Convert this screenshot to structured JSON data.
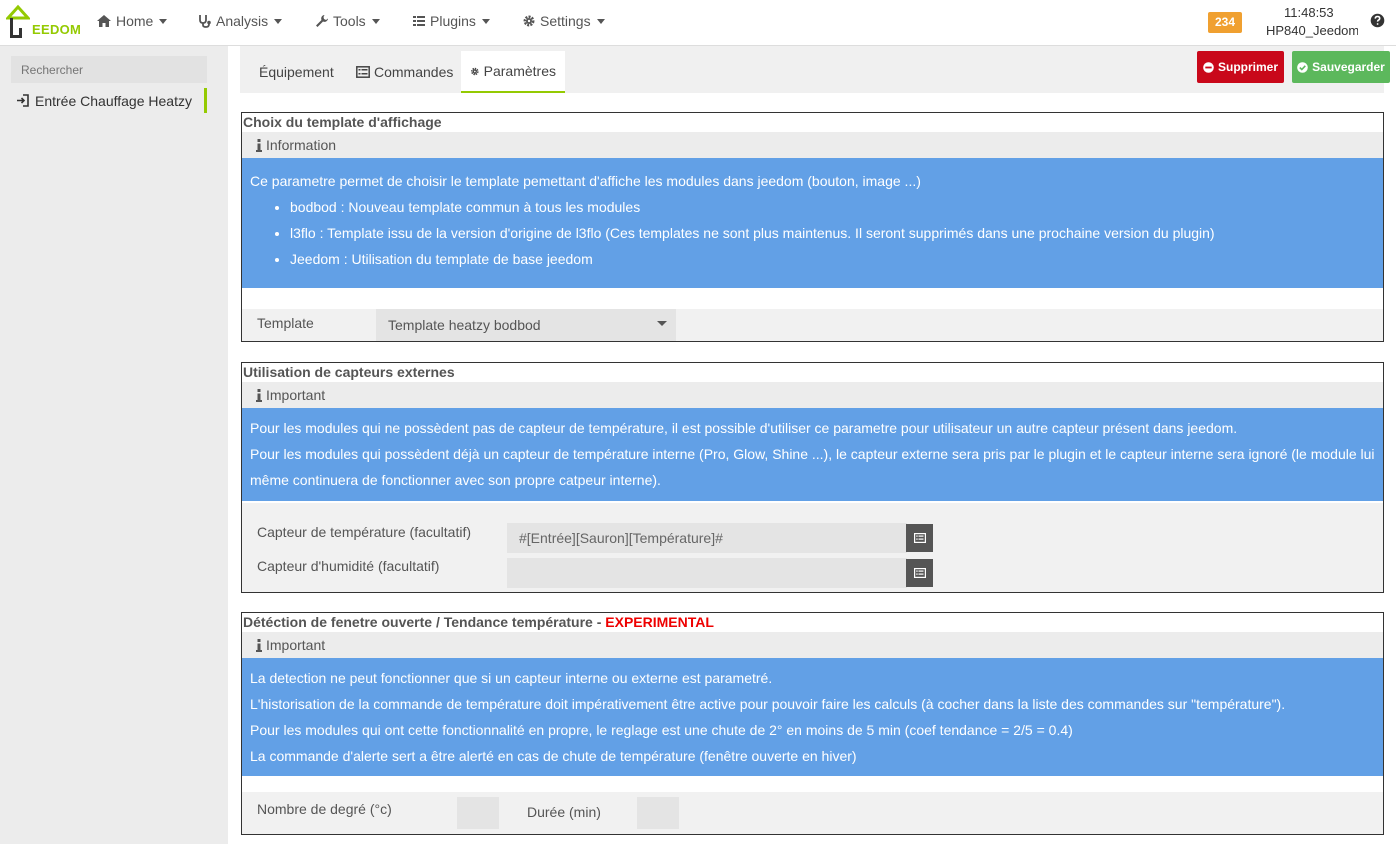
{
  "topbar": {
    "logo_text": "EEDOM",
    "menu": [
      {
        "label": "Home",
        "icon": "home-icon"
      },
      {
        "label": "Analysis",
        "icon": "stethoscope-icon"
      },
      {
        "label": "Tools",
        "icon": "wrench-icon"
      },
      {
        "label": "Plugins",
        "icon": "tasks-icon"
      },
      {
        "label": "Settings",
        "icon": "gear-icon"
      }
    ],
    "badge_count": "234",
    "badge_color": "#f0a030",
    "time": "11:48:53",
    "hostname": "HP840_Jeedom"
  },
  "sidebar": {
    "search_placeholder": "Rechercher",
    "items": [
      {
        "label": "Entrée Chauffage Heatzy",
        "icon": "sign-in-icon"
      }
    ]
  },
  "tabs": [
    {
      "label": "Équipement",
      "active": false
    },
    {
      "label": "Commandes",
      "icon": "list-icon",
      "active": false
    },
    {
      "label": "Paramètres",
      "icon": "gear-icon",
      "active": true
    }
  ],
  "actions": {
    "delete_label": "Supprimer",
    "save_label": "Sauvegarder",
    "delete_color": "#c9081a",
    "save_color": "#5cb85c"
  },
  "accent_color": "#94ca02",
  "info_color": "#62a0e6",
  "sections": {
    "template": {
      "title": "Choix du template d'affichage",
      "subtitle": "Information",
      "intro": "Ce parametre permet de choisir le template pemettant d'affiche les modules dans jeedom (bouton, image ...)",
      "bullets": [
        "bodbod : Nouveau template commun à tous les modules",
        "l3flo : Template issu de la version d'origine de l3flo (Ces templates ne sont plus maintenus. Il seront supprimés dans une prochaine version du plugin)",
        "Jeedom : Utilisation du template de base jeedom"
      ],
      "field_label": "Template",
      "field_value": "Template heatzy bodbod"
    },
    "sensors": {
      "title": "Utilisation de capteurs externes",
      "subtitle": "Important",
      "lines": [
        "Pour les modules qui ne possèdent pas de capteur de température, il est possible d'utiliser ce parametre pour utilisateur un autre capteur présent dans jeedom.",
        "Pour les modules qui possèdent déjà un capteur de température interne (Pro, Glow, Shine ...), le capteur externe sera pris par le plugin et le capteur interne sera ignoré (le module lui même continuera de fonctionner avec son propre catpeur interne)."
      ],
      "temp_label": "Capteur de température (facultatif)",
      "temp_value": "#[Entrée][Sauron][Température]#",
      "hum_label": "Capteur d'humidité (facultatif)",
      "hum_value": ""
    },
    "window": {
      "title": "Détéction de fenetre ouverte / Tendance température - ",
      "title_flag": "EXPERIMENTAL",
      "subtitle": "Important",
      "lines": [
        "La detection ne peut fonctionner que si un capteur interne ou externe est parametré.",
        "L'historisation de la commande de température doit impérativement être active pour pouvoir faire les calculs (à cocher dans la liste des commandes sur \"température\").",
        "Pour les modules qui ont cette fonctionnalité en propre, le reglage est une chute de 2° en moins de 5 min (coef tendance = 2/5 = 0.4)",
        "La commande d'alerte sert a être alerté en cas de chute de température (fenêtre ouverte en hiver)"
      ],
      "degree_label": "Nombre de degré (°c)",
      "duration_label": "Durée (min)"
    }
  }
}
